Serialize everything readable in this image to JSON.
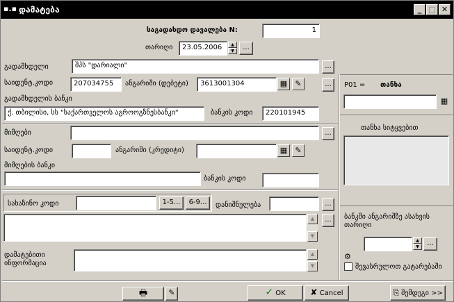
{
  "window": {
    "title": "დამატება"
  },
  "header": {
    "doc_title": "საგადახდო დავალება  N:",
    "doc_number": "1",
    "date_label": "თარიღი",
    "date_value": "23.05.2006"
  },
  "payer": {
    "label": "გადამხდელი",
    "value": "შპს \"დარიალი\"",
    "tax_code_label": "საიდენტ.კოდი",
    "tax_code": "207034755",
    "account_label": "ანგარიში (დებეტი)",
    "account": "3613001304",
    "bank_label": "გადამხდელის ბანკი",
    "bank_name": "ქ. თბილისი, სს \"საქართველოს აგროოგზნესბანკი\"",
    "bank_code_label": "ბანკის კოდი",
    "bank_code": "220101945"
  },
  "receiver": {
    "label": "მიმღები",
    "value": "",
    "tax_code_label": "საიდენტ.კოდი",
    "tax_code": "",
    "account_label": "ანგარიში (კრედიტი)",
    "account": "",
    "bank_label": "მიმღების ბანკი",
    "bank_name": "",
    "bank_code_label": "ბანკის კოდი",
    "bank_code": ""
  },
  "treasury": {
    "label": "სახაზინო კოდი",
    "value": "",
    "btn1": "1-5...",
    "btn2": "6-9...",
    "purpose_label": "დანიშნულება",
    "purpose_value": ""
  },
  "additional": {
    "label_line1": "დამატებითი",
    "label_line2": "ინფორმაცია"
  },
  "right_panel": {
    "code_label": "P01 =",
    "amount_label": "თანხა",
    "amount_value": "",
    "amount_words_label": "თანხა სიტყვებით",
    "bank_date_label_line1": "ბანკში ანგარიშზე ასახვის",
    "bank_date_label_line2": "თარიღი",
    "completed_label": "შევასრულოთ გატარებაში"
  },
  "footer": {
    "ok_label": "OK",
    "cancel_label": "Cancel",
    "next_label": "შემდეგი >>"
  },
  "icons": {
    "ok": "check-icon",
    "cancel": "x-icon",
    "print": "printer-icon"
  },
  "colors": {
    "titlebar": "#000000",
    "window_bg": "#d4d0c8",
    "cancel_x": "#000000",
    "ok_check": "#1a7f1a"
  }
}
